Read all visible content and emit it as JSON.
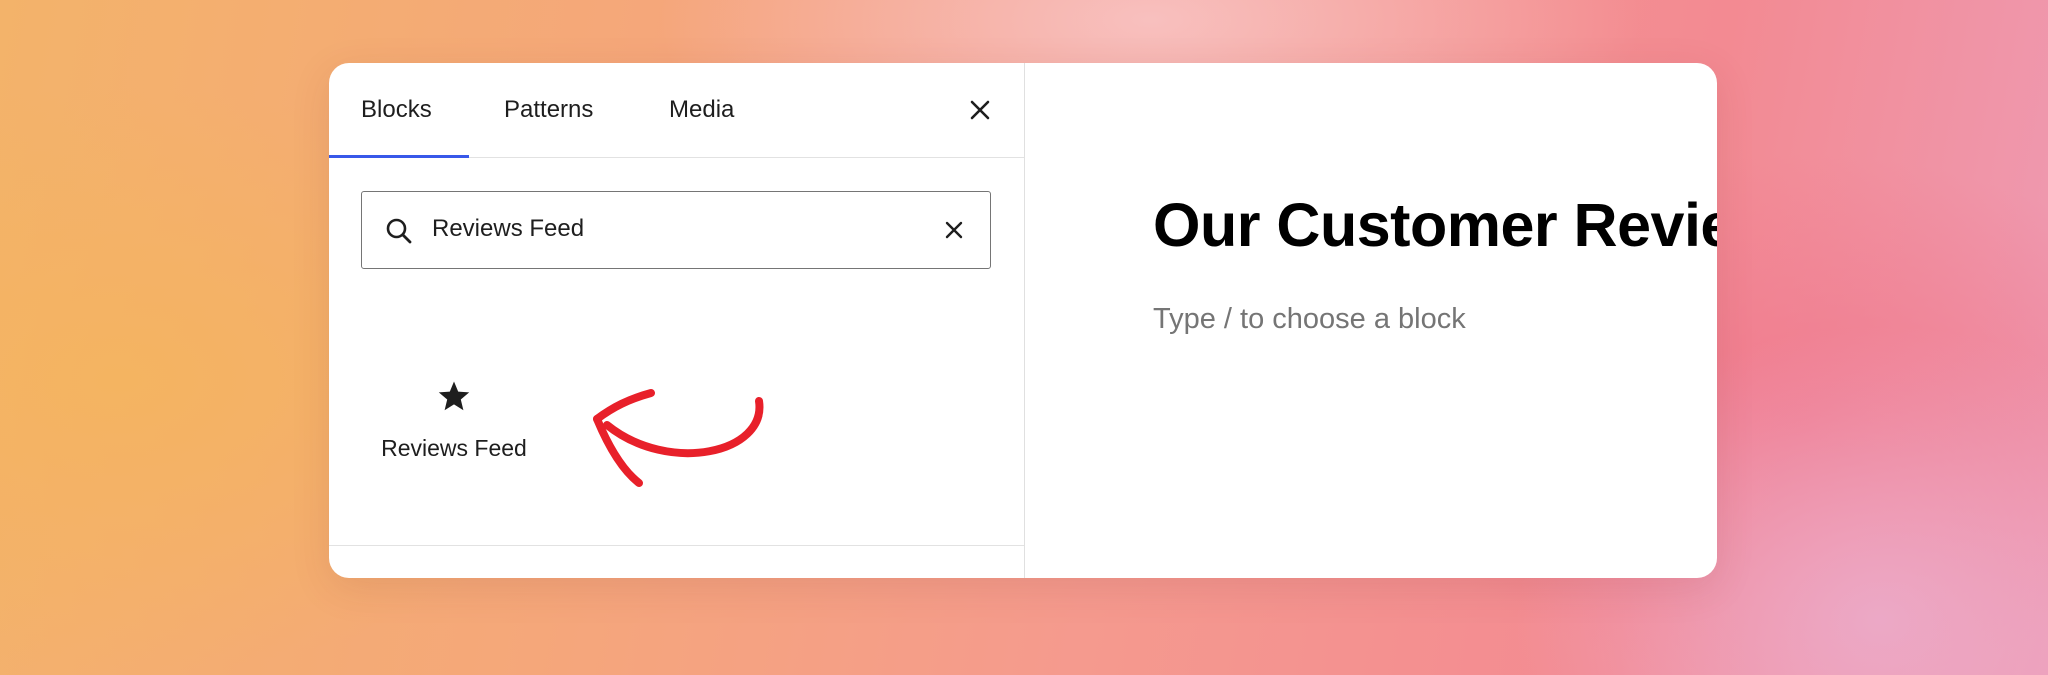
{
  "inserter": {
    "tabs": [
      {
        "label": "Blocks",
        "active": true
      },
      {
        "label": "Patterns",
        "active": false
      },
      {
        "label": "Media",
        "active": false
      }
    ],
    "close_icon": "close-icon",
    "search": {
      "value": "Reviews Feed",
      "icon": "search-icon",
      "clear_icon": "clear-icon"
    },
    "results": [
      {
        "label": "Reviews Feed",
        "icon": "star-icon"
      }
    ],
    "accent_color": "#3858e9",
    "annotation_color": "#e8202a"
  },
  "editor": {
    "title": "Our Customer Reviews",
    "placeholder": "Type / to choose a block"
  }
}
